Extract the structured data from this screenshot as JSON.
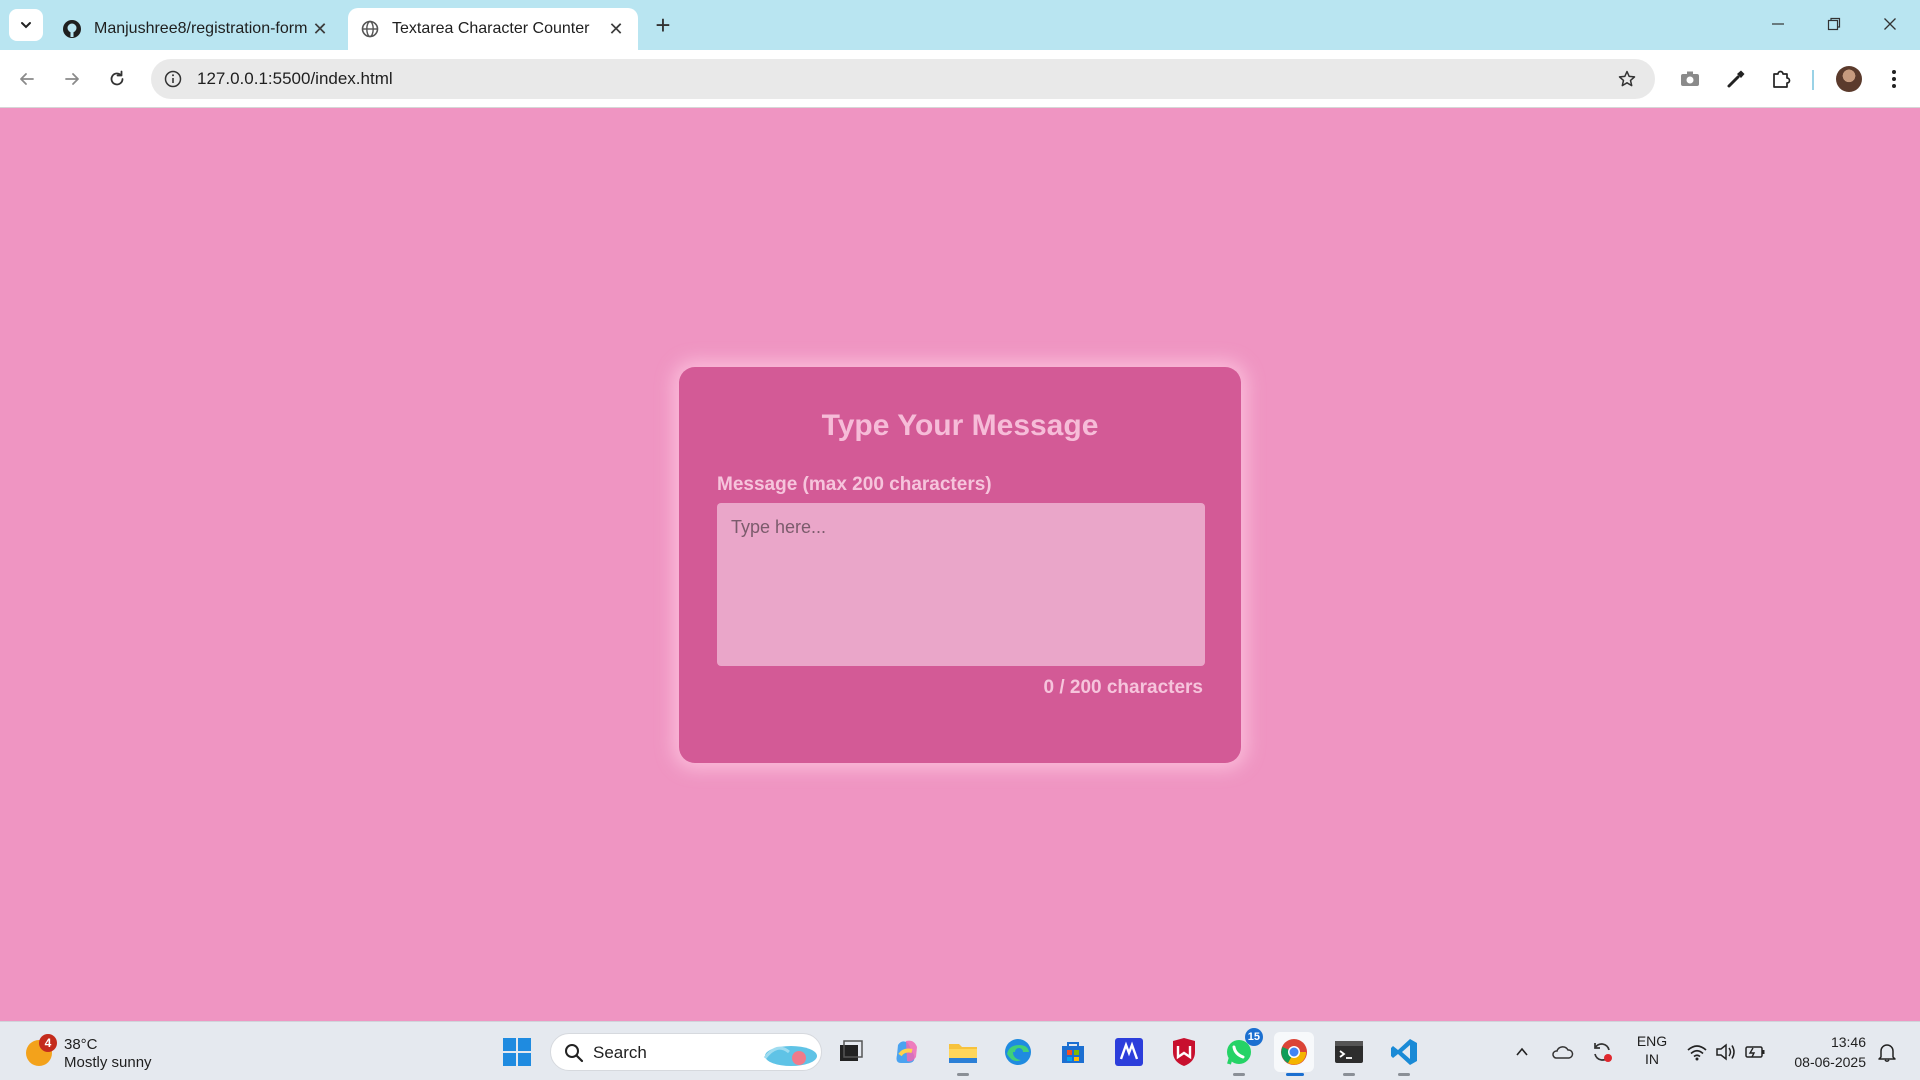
{
  "browser": {
    "tabs": [
      {
        "title": "Manjushree8/registration-form",
        "active": false,
        "icon": "github-icon"
      },
      {
        "title": "Textarea Character Counter",
        "active": true,
        "icon": "globe-icon"
      }
    ],
    "url": "127.0.0.1:5500/index.html",
    "tab_close_glyph": "✕",
    "new_tab_glyph": "+",
    "window_controls": {
      "minimize": "—",
      "restore": "❐",
      "close": "✕"
    }
  },
  "page": {
    "heading": "Type Your Message",
    "label": "Message (max 200 characters)",
    "textarea": {
      "placeholder": "Type here...",
      "value": ""
    },
    "counter": "0 / 200 characters",
    "colors": {
      "background": "#ef95c2",
      "card": "#d35a96",
      "text": "#f6c4dc"
    }
  },
  "taskbar": {
    "weather": {
      "temp": "38°C",
      "condition": "Mostly sunny",
      "alert_count": "4"
    },
    "search_placeholder": "Search",
    "whatsapp_badge": "15",
    "language": {
      "line1": "ENG",
      "line2": "IN"
    },
    "clock": {
      "time": "13:46",
      "date": "08-06-2025"
    }
  }
}
